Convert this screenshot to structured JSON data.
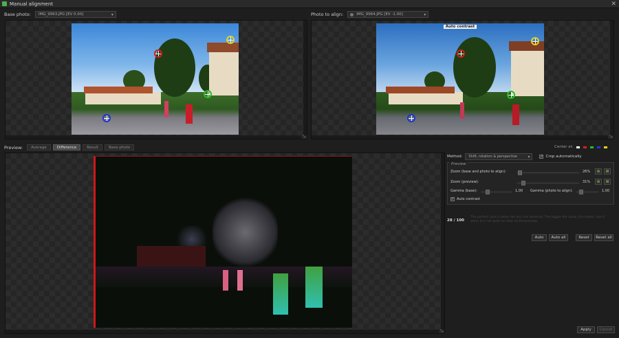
{
  "window": {
    "title": "Manual alignment",
    "close_glyph": "✕"
  },
  "base_photo": {
    "label": "Base photo:",
    "value": "IMG_9963.JPG [EV 0.00]"
  },
  "photo_to_align": {
    "label": "Photo to align:",
    "value": "IMG_9964.JPG [EV -1.00]"
  },
  "auto_contrast_overlay": "Auto contrast",
  "preview_tabs": {
    "label": "Preview:",
    "tabs": [
      "Average",
      "Difference",
      "Result",
      "Base photo"
    ],
    "active": "Difference"
  },
  "center_at": {
    "label": "Center at:",
    "colors": [
      "#ffffff",
      "#e01b1b",
      "#22c022",
      "#1c36d8",
      "#e6d21a"
    ]
  },
  "method": {
    "label": "Method:",
    "value": "Shift, rotation & perspective",
    "crop_label": "Crop automatically",
    "crop_checked": true
  },
  "preview_group": {
    "title": "Preview",
    "zoom_base_label": "Zoom (base and photo to align):",
    "zoom_base_value": "26%",
    "zoom_preview_label": "Zoom (preview):",
    "zoom_preview_value": "31%",
    "gamma_base_label": "Gamma (base):",
    "gamma_base_value": "1,00",
    "gamma_align_label": "Gamma (photo to align):",
    "gamma_align_value": "1,00",
    "auto_contrast_label": "Auto contrast",
    "auto_contrast_checked": true
  },
  "score": {
    "value": "28 / 100",
    "help": "The perfect case is when the pics are identical. The bigger the value, the better. Use it when it is not quite as clear as the preview."
  },
  "buttons": {
    "auto": "Auto",
    "auto_all": "Auto all",
    "reset": "Reset",
    "reset_all": "Reset all",
    "apply": "Apply",
    "cancel": "Cancel"
  },
  "icons": {
    "zoom_in": "zoom-in-icon",
    "zoom_fit": "zoom-fit-icon",
    "resize": "resize-corner-icon"
  },
  "markers": {
    "colors": [
      "#d81b1b",
      "#e6d21a",
      "#22c022",
      "#1c36d8"
    ]
  }
}
